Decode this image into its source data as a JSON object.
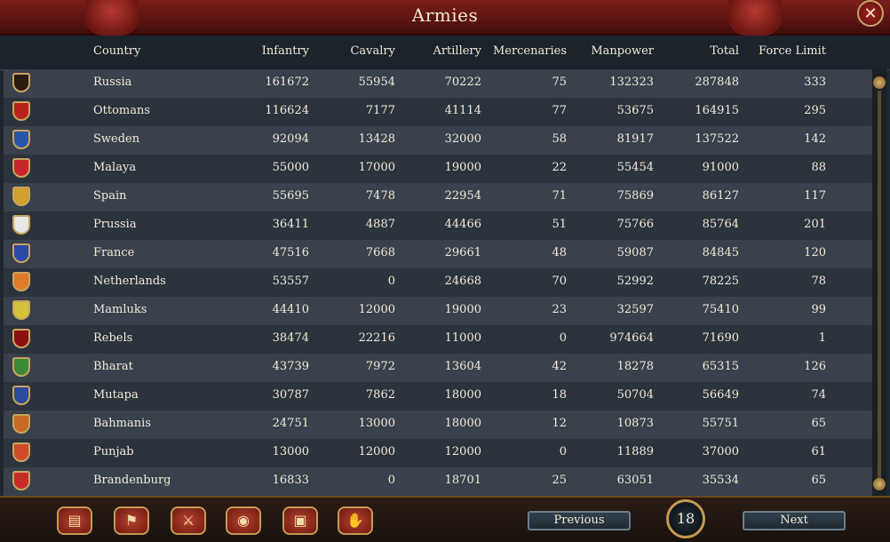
{
  "window": {
    "title": "Armies"
  },
  "columns": {
    "country": "Country",
    "infantry": "Infantry",
    "cavalry": "Cavalry",
    "artillery": "Artillery",
    "mercenaries": "Mercenaries",
    "manpower": "Manpower",
    "total": "Total",
    "force_limit": "Force Limit"
  },
  "rows": [
    {
      "country": "Russia",
      "infantry": "161672",
      "cavalry": "55954",
      "artillery": "70222",
      "mercenaries": "75",
      "manpower": "132323",
      "total": "287848",
      "force_limit": "333",
      "flag": "#2a1a10"
    },
    {
      "country": "Ottomans",
      "infantry": "116624",
      "cavalry": "7177",
      "artillery": "41114",
      "mercenaries": "77",
      "manpower": "53675",
      "total": "164915",
      "force_limit": "295",
      "flag": "#b8221c"
    },
    {
      "country": "Sweden",
      "infantry": "92094",
      "cavalry": "13428",
      "artillery": "32000",
      "mercenaries": "58",
      "manpower": "81917",
      "total": "137522",
      "force_limit": "142",
      "flag": "#2a56a8"
    },
    {
      "country": "Malaya",
      "infantry": "55000",
      "cavalry": "17000",
      "artillery": "19000",
      "mercenaries": "22",
      "manpower": "55454",
      "total": "91000",
      "force_limit": "88",
      "flag": "#c8262a"
    },
    {
      "country": "Spain",
      "infantry": "55695",
      "cavalry": "7478",
      "artillery": "22954",
      "mercenaries": "71",
      "manpower": "75869",
      "total": "86127",
      "force_limit": "117",
      "flag": "#d2a02c"
    },
    {
      "country": "Prussia",
      "infantry": "36411",
      "cavalry": "4887",
      "artillery": "44466",
      "mercenaries": "51",
      "manpower": "75766",
      "total": "85764",
      "force_limit": "201",
      "flag": "#e8e8e8"
    },
    {
      "country": "France",
      "infantry": "47516",
      "cavalry": "7668",
      "artillery": "29661",
      "mercenaries": "48",
      "manpower": "59087",
      "total": "84845",
      "force_limit": "120",
      "flag": "#2a4aa6"
    },
    {
      "country": "Netherlands",
      "infantry": "53557",
      "cavalry": "0",
      "artillery": "24668",
      "mercenaries": "70",
      "manpower": "52992",
      "total": "78225",
      "force_limit": "78",
      "flag": "#e07a2a"
    },
    {
      "country": "Mamluks",
      "infantry": "44410",
      "cavalry": "12000",
      "artillery": "19000",
      "mercenaries": "23",
      "manpower": "32597",
      "total": "75410",
      "force_limit": "99",
      "flag": "#d6c23a"
    },
    {
      "country": "Rebels",
      "infantry": "38474",
      "cavalry": "22216",
      "artillery": "11000",
      "mercenaries": "0",
      "manpower": "974664",
      "total": "71690",
      "force_limit": "1",
      "flag": "#8a1010"
    },
    {
      "country": "Bharat",
      "infantry": "43739",
      "cavalry": "7972",
      "artillery": "13604",
      "mercenaries": "42",
      "manpower": "18278",
      "total": "65315",
      "force_limit": "126",
      "flag": "#3a8a3a"
    },
    {
      "country": "Mutapa",
      "infantry": "30787",
      "cavalry": "7862",
      "artillery": "18000",
      "mercenaries": "18",
      "manpower": "50704",
      "total": "56649",
      "force_limit": "74",
      "flag": "#2a4c9c"
    },
    {
      "country": "Bahmanis",
      "infantry": "24751",
      "cavalry": "13000",
      "artillery": "18000",
      "mercenaries": "12",
      "manpower": "10873",
      "total": "55751",
      "force_limit": "65",
      "flag": "#c86a22"
    },
    {
      "country": "Punjab",
      "infantry": "13000",
      "cavalry": "12000",
      "artillery": "12000",
      "mercenaries": "0",
      "manpower": "11889",
      "total": "37000",
      "force_limit": "61",
      "flag": "#d04a2a"
    },
    {
      "country": "Brandenburg",
      "infantry": "16833",
      "cavalry": "0",
      "artillery": "18701",
      "mercenaries": "25",
      "manpower": "63051",
      "total": "35534",
      "force_limit": "65",
      "flag": "#c82a2a"
    }
  ],
  "footer": {
    "buttons": [
      {
        "name": "ledger-icon",
        "glyph": "▤"
      },
      {
        "name": "flag-icon",
        "glyph": "⚑"
      },
      {
        "name": "crossed-swords-icon",
        "glyph": "⚔"
      },
      {
        "name": "coins-icon",
        "glyph": "◉"
      },
      {
        "name": "trade-goods-icon",
        "glyph": "▣"
      },
      {
        "name": "handshake-icon",
        "glyph": "✋"
      }
    ],
    "previous_label": "Previous",
    "next_label": "Next",
    "page_number": "18"
  },
  "close_glyph": "✕"
}
